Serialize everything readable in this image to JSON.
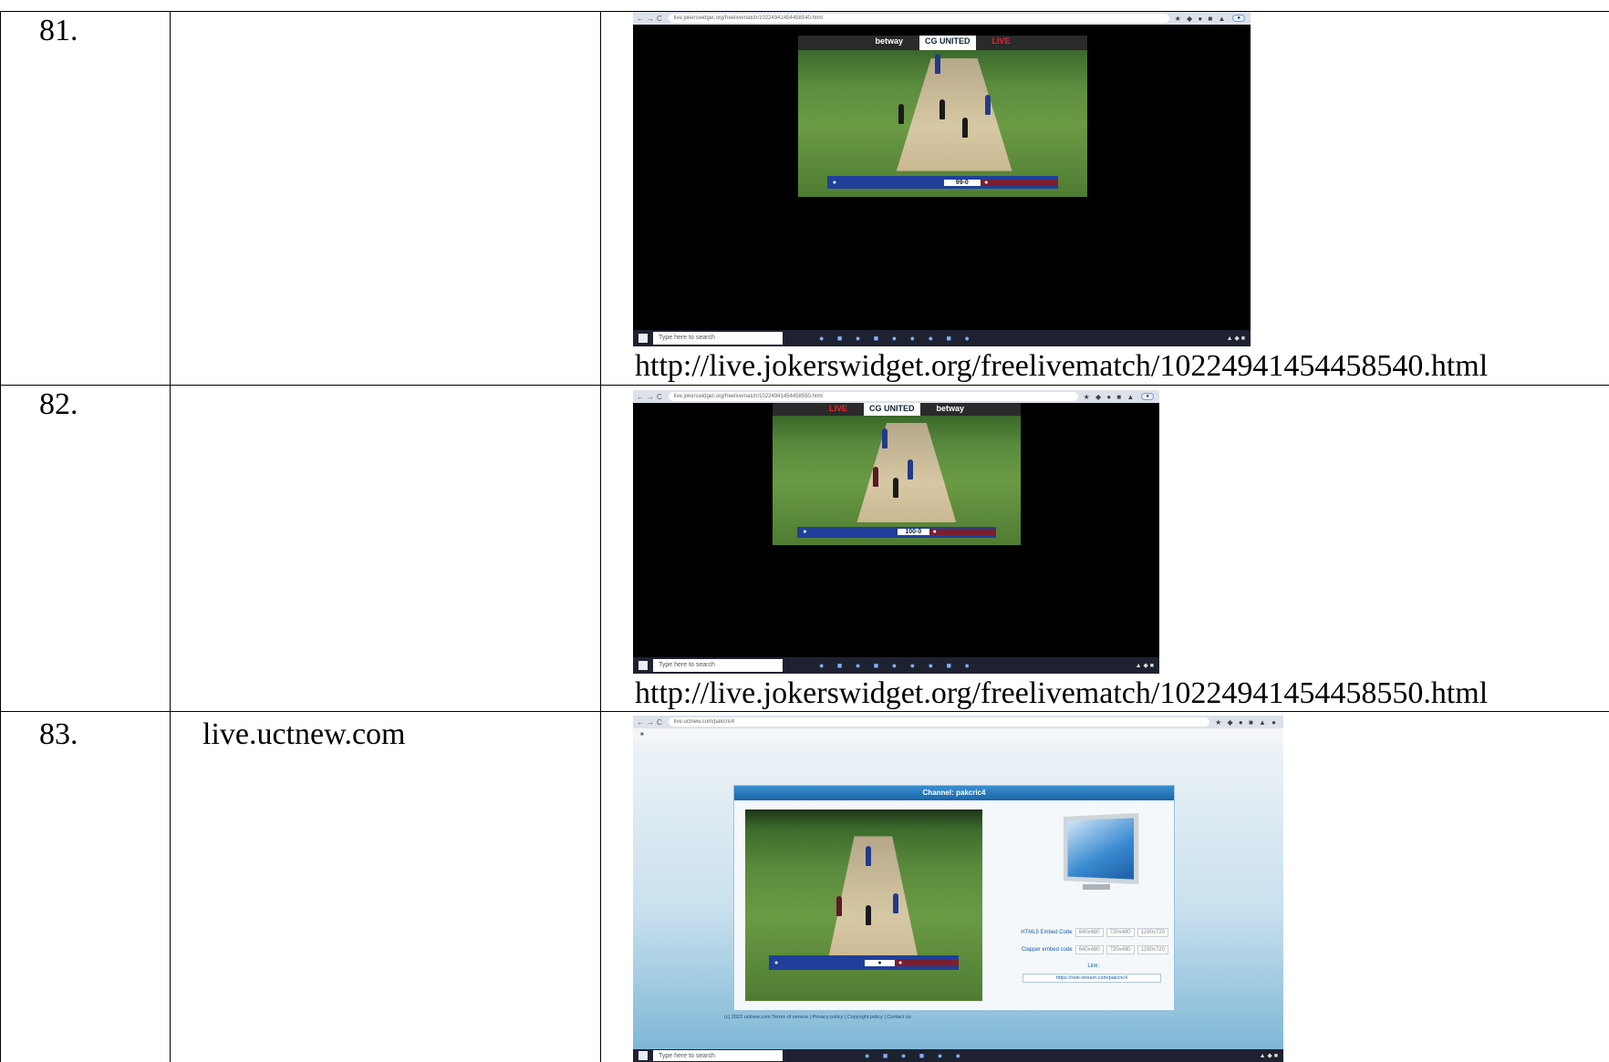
{
  "rows": [
    {
      "sno": "81.",
      "site": "",
      "url": "http://live.jokerswidget.org/freelivematch/10224941454458540.html",
      "shot": {
        "address": "live.jokerswidget.org/freelivematch/10224941454458540.html",
        "sponsors": [
          "betway",
          "CG UNITED",
          "LIVE"
        ],
        "score": "99-0",
        "search_placeholder": "Type here to search"
      }
    },
    {
      "sno": "82.",
      "site": "",
      "url": "http://live.jokerswidget.org/freelivematch/10224941454458550.html",
      "shot": {
        "address": "live.jokerswidget.org/freelivematch/10224941454458550.html",
        "sponsors": [
          "LIVE",
          "CG UNITED",
          "betway"
        ],
        "score": "100-0",
        "search_placeholder": "Type here to search"
      }
    },
    {
      "sno": "83.",
      "site": "live.uctnew.com",
      "url": "",
      "shot": {
        "address": "live.uctnew.com/pakcric4",
        "channel_title": "Channel: pakcric4",
        "html5_label": "HTML5 Embed Code",
        "clapper_label": "Clapper embed code",
        "sizes": [
          "640x480",
          "720x480",
          "1280x720"
        ],
        "link_label": "Link:",
        "link_value": "https://redi-stream.com/pakcric4",
        "footer": "(c) 2022 uctnew.com Terms of service | Privacy policy | Copyright policy | Contact us",
        "search_placeholder": "Type here to search"
      }
    }
  ]
}
